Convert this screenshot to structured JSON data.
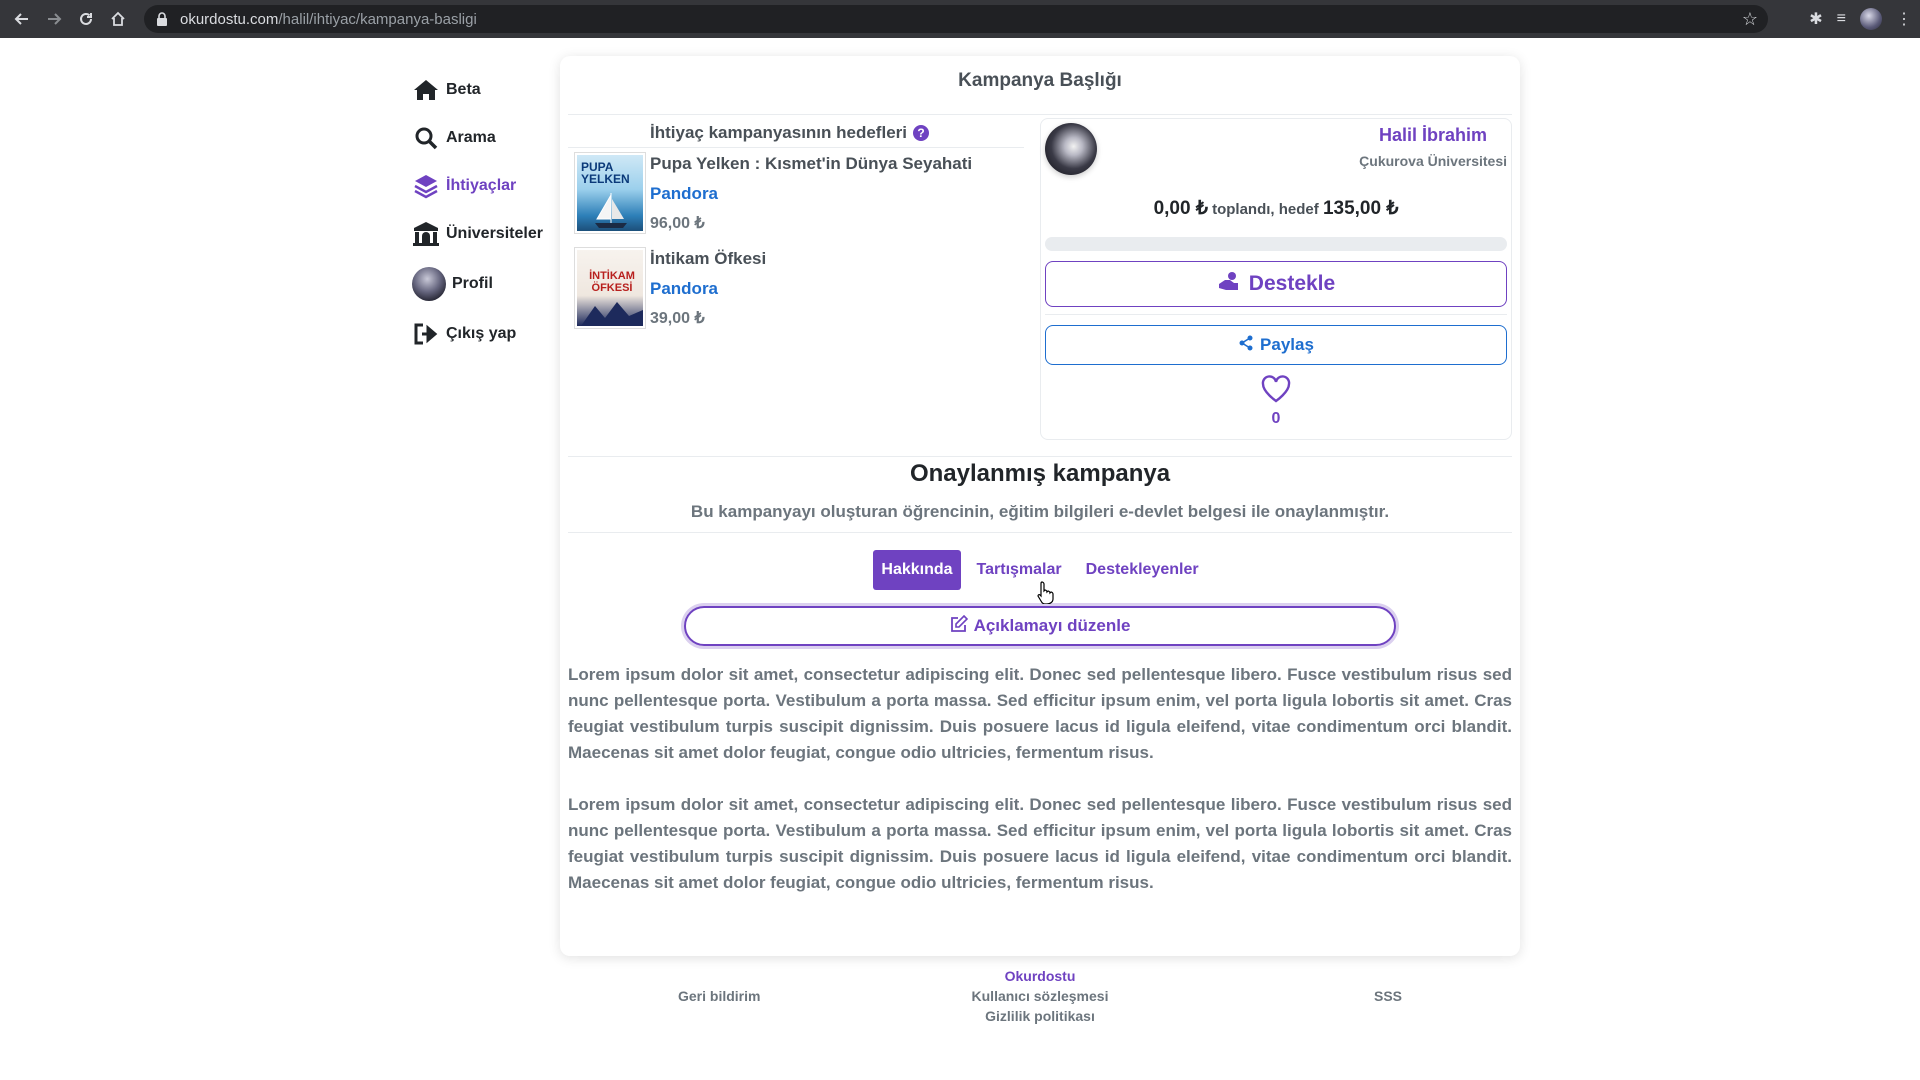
{
  "browser": {
    "url_host": "okurdostu.com",
    "url_path": "/halil/ihtiyac/kampanya-basligi"
  },
  "sidebar": {
    "items": [
      {
        "label": "Beta",
        "icon": "home-icon"
      },
      {
        "label": "Arama",
        "icon": "search-icon"
      },
      {
        "label": "İhtiyaçlar",
        "icon": "layers-icon",
        "active": true
      },
      {
        "label": "Üniversiteler",
        "icon": "university-icon"
      },
      {
        "label": "Profil",
        "icon": "avatar"
      },
      {
        "label": "Çıkış yap",
        "icon": "logout-icon"
      }
    ]
  },
  "campaign": {
    "title": "Kampanya Başlığı",
    "goals_heading": "İhtiyaç kampanyasının hedefleri",
    "books": [
      {
        "title": "Pupa Yelken : Kısmet'in Dünya Seyahati",
        "publisher": "Pandora",
        "price": "96,00 ₺",
        "cover_text": "PUPA YELKEN"
      },
      {
        "title": "İntikam Öfkesi",
        "publisher": "Pandora",
        "price": "39,00 ₺",
        "cover_text": "İNTİKAM ÖFKESİ"
      }
    ]
  },
  "creator": {
    "name": "Halil İbrahim",
    "university": "Çukurova Üniversitesi"
  },
  "funding": {
    "raised": "0,00 ₺",
    "raised_label": "toplandı, hedef",
    "target": "135,00 ₺",
    "progress_fraction": 0
  },
  "actions": {
    "support_label": "Destekle",
    "share_label": "Paylaş",
    "like_count": "0"
  },
  "approval": {
    "heading": "Onaylanmış kampanya",
    "text": "Bu kampanyayı oluşturan öğrencinin, eğitim bilgileri e-devlet belgesi ile onaylanmıştır."
  },
  "tabs": [
    {
      "label": "Hakkında",
      "active": true
    },
    {
      "label": "Tartışmalar",
      "active": false
    },
    {
      "label": "Destekleyenler",
      "active": false
    }
  ],
  "edit_label": "Açıklamayı düzenle",
  "description": [
    "Lorem ipsum dolor sit amet, consectetur adipiscing elit. Donec sed pellentesque libero. Fusce vestibulum risus sed nunc pellentesque porta. Vestibulum a porta massa. Sed efficitur ipsum enim, vel porta ligula lobortis sit amet. Cras feugiat vestibulum turpis suscipit dignissim. Duis posuere lacus id ligula eleifend, vitae condimentum orci blandit. Maecenas sit amet dolor feugiat, congue odio ultricies, fermentum risus.",
    "Lorem ipsum dolor sit amet, consectetur adipiscing elit. Donec sed pellentesque libero. Fusce vestibulum risus sed nunc pellentesque porta. Vestibulum a porta massa. Sed efficitur ipsum enim, vel porta ligula lobortis sit amet. Cras feugiat vestibulum turpis suscipit dignissim. Duis posuere lacus id ligula eleifend, vitae condimentum orci blandit. Maecenas sit amet dolor feugiat, congue odio ultricies, fermentum risus."
  ],
  "footer": {
    "feedback": "Geri bildirim",
    "brand": "Okurdostu",
    "terms": "Kullanıcı sözleşmesi",
    "privacy": "Gizlilik politikası",
    "faq": "SSS"
  },
  "colors": {
    "accent": "#6f42c1",
    "link_blue": "#1e6ecf",
    "muted": "#6c757d"
  }
}
